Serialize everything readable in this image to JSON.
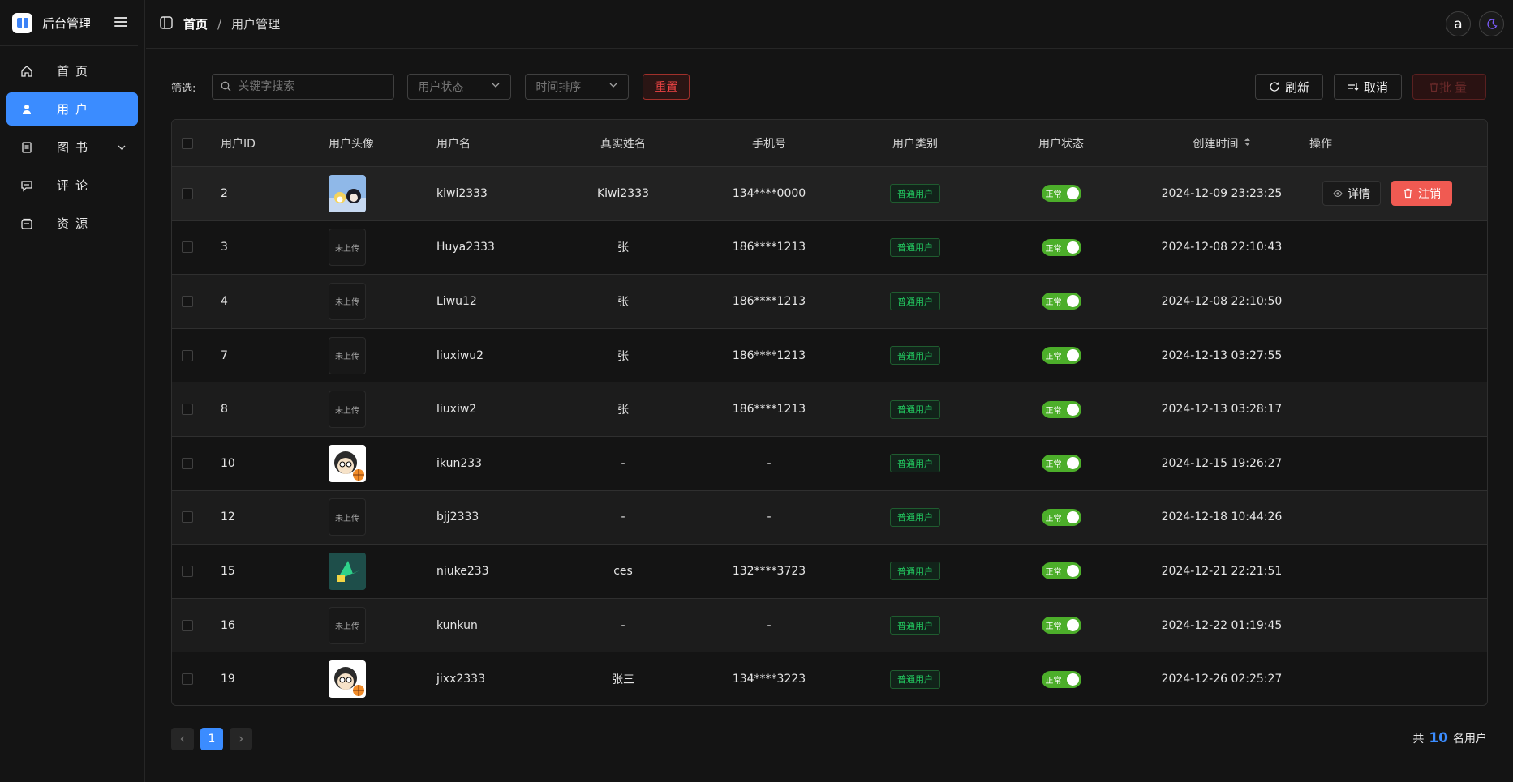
{
  "app": {
    "title": "后台管理"
  },
  "sidebar": {
    "items": [
      {
        "label": "首页",
        "icon": "home-icon"
      },
      {
        "label": "用户",
        "icon": "user-icon",
        "active": true
      },
      {
        "label": "图书",
        "icon": "book-icon",
        "expandable": true
      },
      {
        "label": "评论",
        "icon": "comment-icon"
      },
      {
        "label": "资源",
        "icon": "resource-icon"
      }
    ]
  },
  "breadcrumb": {
    "home": "首页",
    "separator": "/",
    "current": "用户管理"
  },
  "header": {
    "avatar_letter": "a"
  },
  "filters": {
    "label": "筛选:",
    "search_placeholder": "关键字搜索",
    "status_placeholder": "用户状态",
    "sort_placeholder": "时间排序",
    "reset_label": "重置",
    "refresh_label": "刷新",
    "cancel_label": "取消",
    "batch_label": "批量"
  },
  "table": {
    "columns": [
      "用户ID",
      "用户头像",
      "用户名",
      "真实姓名",
      "手机号",
      "用户类别",
      "用户状态",
      "创建时间",
      "操作"
    ],
    "rows": [
      {
        "id": "2",
        "avatar": "image",
        "username": "kiwi2333",
        "realname": "Kiwi2333",
        "phone": "134****0000",
        "type": "普通用户",
        "status": "正常",
        "created": "2024-12-09 23:23:25"
      },
      {
        "id": "3",
        "avatar": "未上传",
        "username": "Huya2333",
        "realname": "张",
        "phone": "186****1213",
        "type": "普通用户",
        "status": "正常",
        "created": "2024-12-08 22:10:43"
      },
      {
        "id": "4",
        "avatar": "未上传",
        "username": "Liwu12",
        "realname": "张",
        "phone": "186****1213",
        "type": "普通用户",
        "status": "正常",
        "created": "2024-12-08 22:10:50"
      },
      {
        "id": "7",
        "avatar": "未上传",
        "username": "liuxiwu2",
        "realname": "张",
        "phone": "186****1213",
        "type": "普通用户",
        "status": "正常",
        "created": "2024-12-13 03:27:55"
      },
      {
        "id": "8",
        "avatar": "未上传",
        "username": "liuxiw2",
        "realname": "张",
        "phone": "186****1213",
        "type": "普通用户",
        "status": "正常",
        "created": "2024-12-13 03:28:17"
      },
      {
        "id": "10",
        "avatar": "image",
        "username": "ikun233",
        "realname": "-",
        "phone": "-",
        "type": "普通用户",
        "status": "正常",
        "created": "2024-12-15 19:26:27"
      },
      {
        "id": "12",
        "avatar": "未上传",
        "username": "bjj2333",
        "realname": "-",
        "phone": "-",
        "type": "普通用户",
        "status": "正常",
        "created": "2024-12-18 10:44:26"
      },
      {
        "id": "15",
        "avatar": "image",
        "username": "niuke233",
        "realname": "ces",
        "phone": "132****3723",
        "type": "普通用户",
        "status": "正常",
        "created": "2024-12-21 22:21:51"
      },
      {
        "id": "16",
        "avatar": "未上传",
        "username": "kunkun",
        "realname": "-",
        "phone": "-",
        "type": "普通用户",
        "status": "正常",
        "created": "2024-12-22 01:19:45"
      },
      {
        "id": "19",
        "avatar": "image",
        "username": "jixx2333",
        "realname": "张三",
        "phone": "134****3223",
        "type": "普通用户",
        "status": "正常",
        "created": "2024-12-26 02:25:27"
      }
    ],
    "actions": {
      "detail": "详情",
      "deactivate": "注销"
    }
  },
  "pagination": {
    "current": "1",
    "total_prefix": "共",
    "total": "10",
    "total_suffix": "名用户"
  },
  "colors": {
    "accent": "#3b8cff",
    "danger": "#f05a52",
    "success": "#4cae2a"
  }
}
